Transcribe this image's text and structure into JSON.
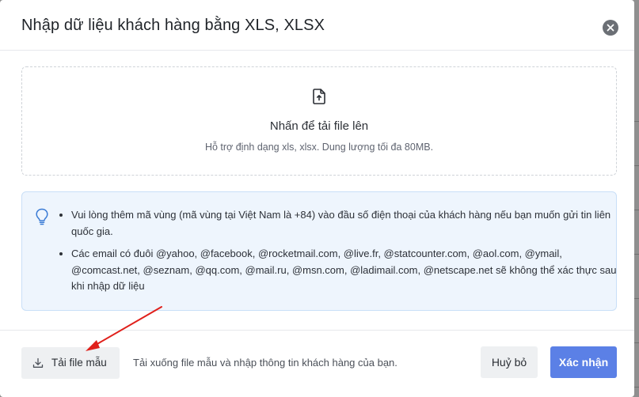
{
  "modal": {
    "title": "Nhập dữ liệu khách hàng bằng XLS, XLSX",
    "close_icon": "close-icon"
  },
  "upload": {
    "icon": "upload-file-icon",
    "title": "Nhấn để tải file lên",
    "subtitle": "Hỗ trợ định dạng xls, xlsx. Dung lượng tối đa 80MB."
  },
  "notice": {
    "icon": "lightbulb-icon",
    "items": [
      "Vui lòng thêm mã vùng (mã vùng tại Việt Nam là +84) vào đầu số điện thoại của khách hàng nếu bạn muốn gửi tin liên quốc gia.",
      "Các email có đuôi @yahoo, @facebook, @rocketmail.com, @live.fr, @statcounter.com, @aol.com, @ymail, @comcast.net, @seznam, @qq.com, @mail.ru, @msn.com, @ladimail.com, @netscape.net sẽ không thể xác thực sau khi nhập dữ liệu"
    ]
  },
  "footer": {
    "download_label": "Tải file mẫu",
    "download_icon": "download-icon",
    "hint": "Tải xuống file mẫu và nhập thông tin khách hàng của bạn.",
    "cancel_label": "Huỷ bỏ",
    "confirm_label": "Xác nhận"
  },
  "colors": {
    "primary": "#5b80e6",
    "annotation_arrow": "#e0201b",
    "notice_bg": "#eef5fd",
    "notice_border": "#c9dff7"
  }
}
